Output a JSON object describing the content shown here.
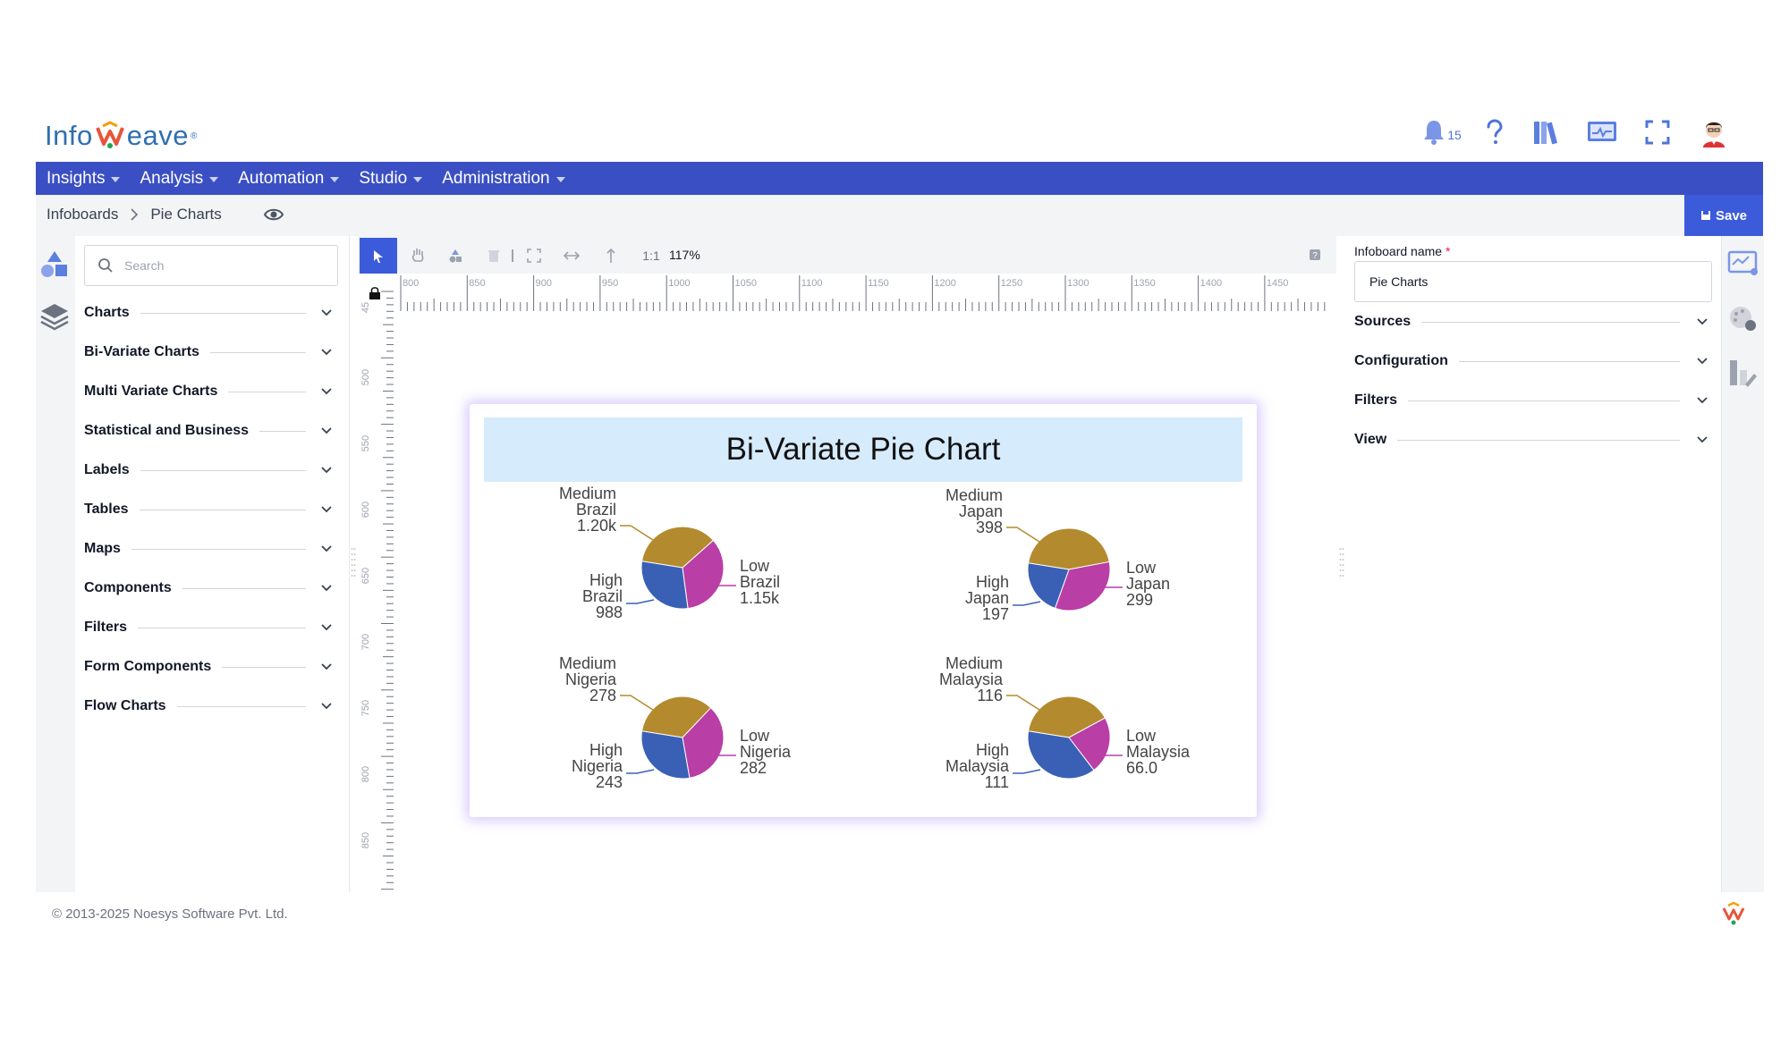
{
  "app": {
    "logo_left": "Info",
    "logo_right": "eave",
    "logo_reg": "®"
  },
  "header": {
    "notification_count": "15"
  },
  "menu": [
    {
      "label": "Insights"
    },
    {
      "label": "Analysis"
    },
    {
      "label": "Automation"
    },
    {
      "label": "Studio"
    },
    {
      "label": "Administration"
    }
  ],
  "breadcrumb": {
    "root": "Infoboards",
    "current": "Pie Charts"
  },
  "save_label": "Save",
  "search": {
    "placeholder": "Search"
  },
  "categories": [
    {
      "label": "Charts"
    },
    {
      "label": "Bi-Variate Charts"
    },
    {
      "label": "Multi Variate Charts"
    },
    {
      "label": "Statistical and Business"
    },
    {
      "label": "Labels"
    },
    {
      "label": "Tables"
    },
    {
      "label": "Maps"
    },
    {
      "label": "Components"
    },
    {
      "label": "Filters"
    },
    {
      "label": "Form Components"
    },
    {
      "label": "Flow Charts"
    }
  ],
  "toolbar": {
    "ratio": "1:1",
    "zoom": "117%"
  },
  "ruler": {
    "top": [
      "800",
      "850",
      "900",
      "950",
      "1000",
      "1050",
      "1100",
      "1150",
      "1200",
      "1250",
      "1300",
      "1350",
      "1400",
      "1450"
    ],
    "left": [
      "45",
      "500",
      "550",
      "600",
      "650",
      "700",
      "750",
      "800",
      "850"
    ]
  },
  "right_panel": {
    "name_label": "Infoboard name",
    "required_mark": "*",
    "name_value": "Pie Charts",
    "sections": [
      {
        "label": "Sources"
      },
      {
        "label": "Configuration"
      },
      {
        "label": "Filters"
      },
      {
        "label": "View"
      }
    ]
  },
  "footer": {
    "copyright": "© 2013-2025 Noesys Software Pvt. Ltd."
  },
  "colors": {
    "medium": "#b48a2e",
    "low": "#b93ea6",
    "high": "#3a60b5",
    "accent": "#3b4fc4"
  },
  "chart_data": {
    "type": "pie",
    "title": "Bi-Variate Pie Chart",
    "pies": [
      {
        "country": "Brazil",
        "slices": [
          {
            "name": "Medium",
            "value": 1200,
            "label": "1.20k"
          },
          {
            "name": "Low",
            "value": 1150,
            "label": "1.15k"
          },
          {
            "name": "High",
            "value": 988,
            "label": "988"
          }
        ]
      },
      {
        "country": "Japan",
        "slices": [
          {
            "name": "Medium",
            "value": 398,
            "label": "398"
          },
          {
            "name": "Low",
            "value": 299,
            "label": "299"
          },
          {
            "name": "High",
            "value": 197,
            "label": "197"
          }
        ]
      },
      {
        "country": "Nigeria",
        "slices": [
          {
            "name": "Medium",
            "value": 278,
            "label": "278"
          },
          {
            "name": "Low",
            "value": 282,
            "label": "282"
          },
          {
            "name": "High",
            "value": 243,
            "label": "243"
          }
        ]
      },
      {
        "country": "Malaysia",
        "slices": [
          {
            "name": "Medium",
            "value": 116,
            "label": "116"
          },
          {
            "name": "Low",
            "value": 66,
            "label": "66.0"
          },
          {
            "name": "High",
            "value": 111,
            "label": "111"
          }
        ]
      }
    ]
  }
}
